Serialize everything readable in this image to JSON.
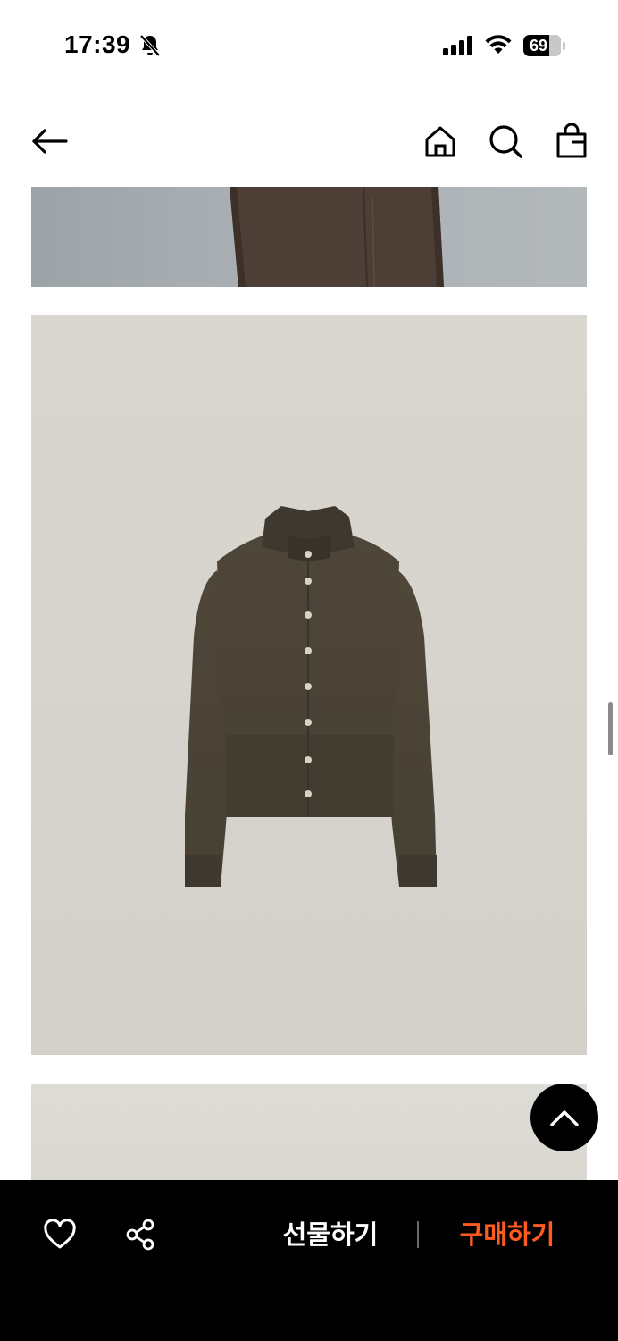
{
  "status_bar": {
    "time": "17:39",
    "battery_level": "69",
    "icons": [
      "bell-slash-icon",
      "cellular-signal-icon",
      "wifi-icon",
      "battery-icon"
    ]
  },
  "nav": {
    "icons": [
      "back-arrow-icon",
      "home-icon",
      "search-icon",
      "shopping-bag-icon"
    ]
  },
  "bottom_bar": {
    "gift_label": "선물하기",
    "buy_label": "구매하기",
    "icons": [
      "heart-icon",
      "share-icon"
    ]
  },
  "colors": {
    "bottom_bar_bg": "#000000",
    "buy_accent": "#ff5a1f",
    "product_color": "#4a4236"
  }
}
